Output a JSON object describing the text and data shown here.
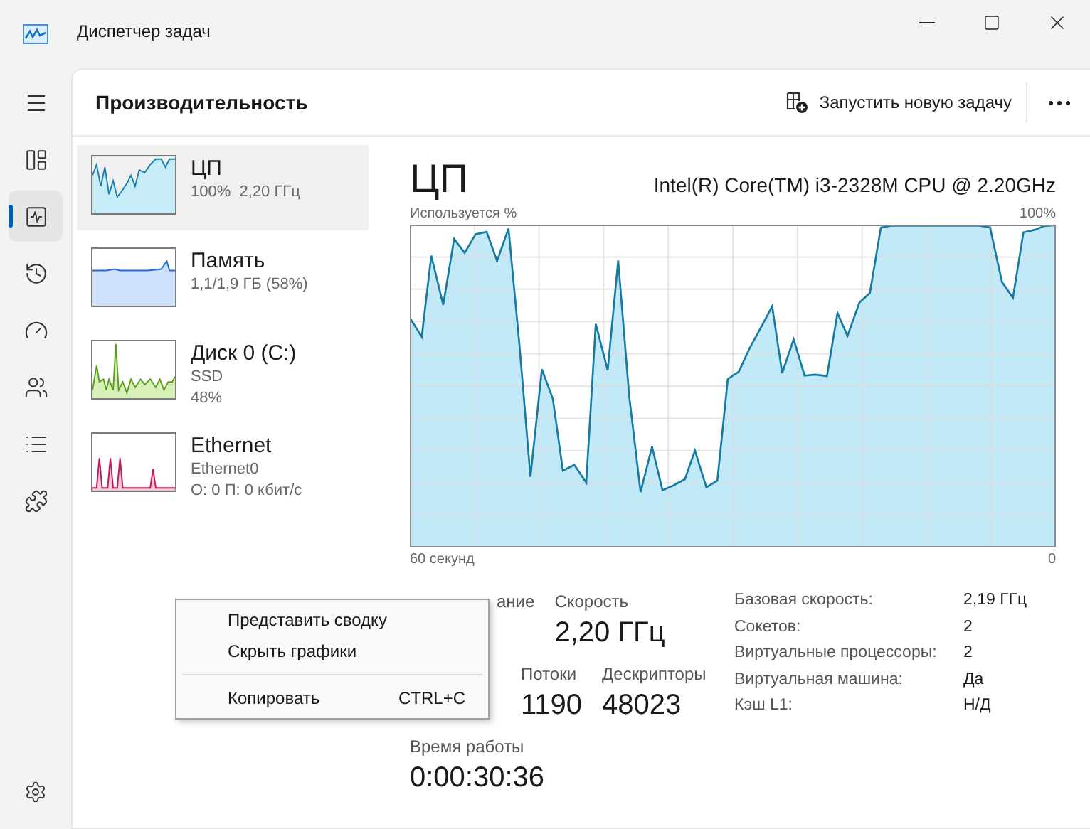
{
  "window": {
    "title": "Диспетчер задач"
  },
  "nav_items": [
    {
      "selected": false
    },
    {
      "selected": false
    },
    {
      "selected": true
    },
    {
      "selected": false
    },
    {
      "selected": false
    },
    {
      "selected": false
    },
    {
      "selected": false
    },
    {
      "selected": false
    }
  ],
  "header": {
    "title": "Производительность",
    "action": "Запустить новую задачу"
  },
  "devices": [
    {
      "kind": "cpu",
      "name": "ЦП",
      "lines": [
        "100%  2,20 ГГц"
      ],
      "selected": true
    },
    {
      "kind": "memory",
      "name": "Память",
      "lines": [
        "1,1/1,9 ГБ (58%)"
      ],
      "selected": false
    },
    {
      "kind": "disk",
      "name": "Диск 0 (C:)",
      "lines": [
        "SSD",
        "48%"
      ],
      "selected": false
    },
    {
      "kind": "network",
      "name": "Ethernet",
      "lines": [
        "Ethernet0",
        "О: 0 П: 0 кбит/с"
      ],
      "selected": false
    }
  ],
  "detail": {
    "title": "ЦП",
    "model": "Intel(R) Core(TM) i3-2328M CPU @ 2.20GHz",
    "graph_label": "Используется %",
    "graph_max": "100%",
    "time_start": "60 секунд",
    "time_end": "0"
  },
  "stats": {
    "row1": [
      {
        "label": "ание"
      },
      {
        "label": "Скорость",
        "value": "2,20 ГГц"
      }
    ],
    "row2": [
      {
        "label": "Потоки",
        "value": "1190"
      },
      {
        "label": "Дескрипторы",
        "value": "48023"
      }
    ],
    "uptime": {
      "label": "Время работы",
      "value": "0:00:30:36"
    }
  },
  "properties": [
    {
      "label": "Базовая скорость:",
      "value": "2,19 ГГц"
    },
    {
      "label": "Сокетов:",
      "value": "2"
    },
    {
      "label": "Виртуальные процессоры:",
      "value": "2"
    },
    {
      "label": "Виртуальная машина:",
      "value": "Да"
    },
    {
      "label": "Кэш L1:",
      "value": "Н/Д"
    }
  ],
  "context_menu": {
    "items": [
      {
        "label": "Представить сводку",
        "separator_before": false
      },
      {
        "label": "Скрыть графики",
        "separator_before": false
      },
      {
        "label": "Копировать",
        "shortcut": "CTRL+C",
        "separator_before": true
      }
    ]
  }
}
